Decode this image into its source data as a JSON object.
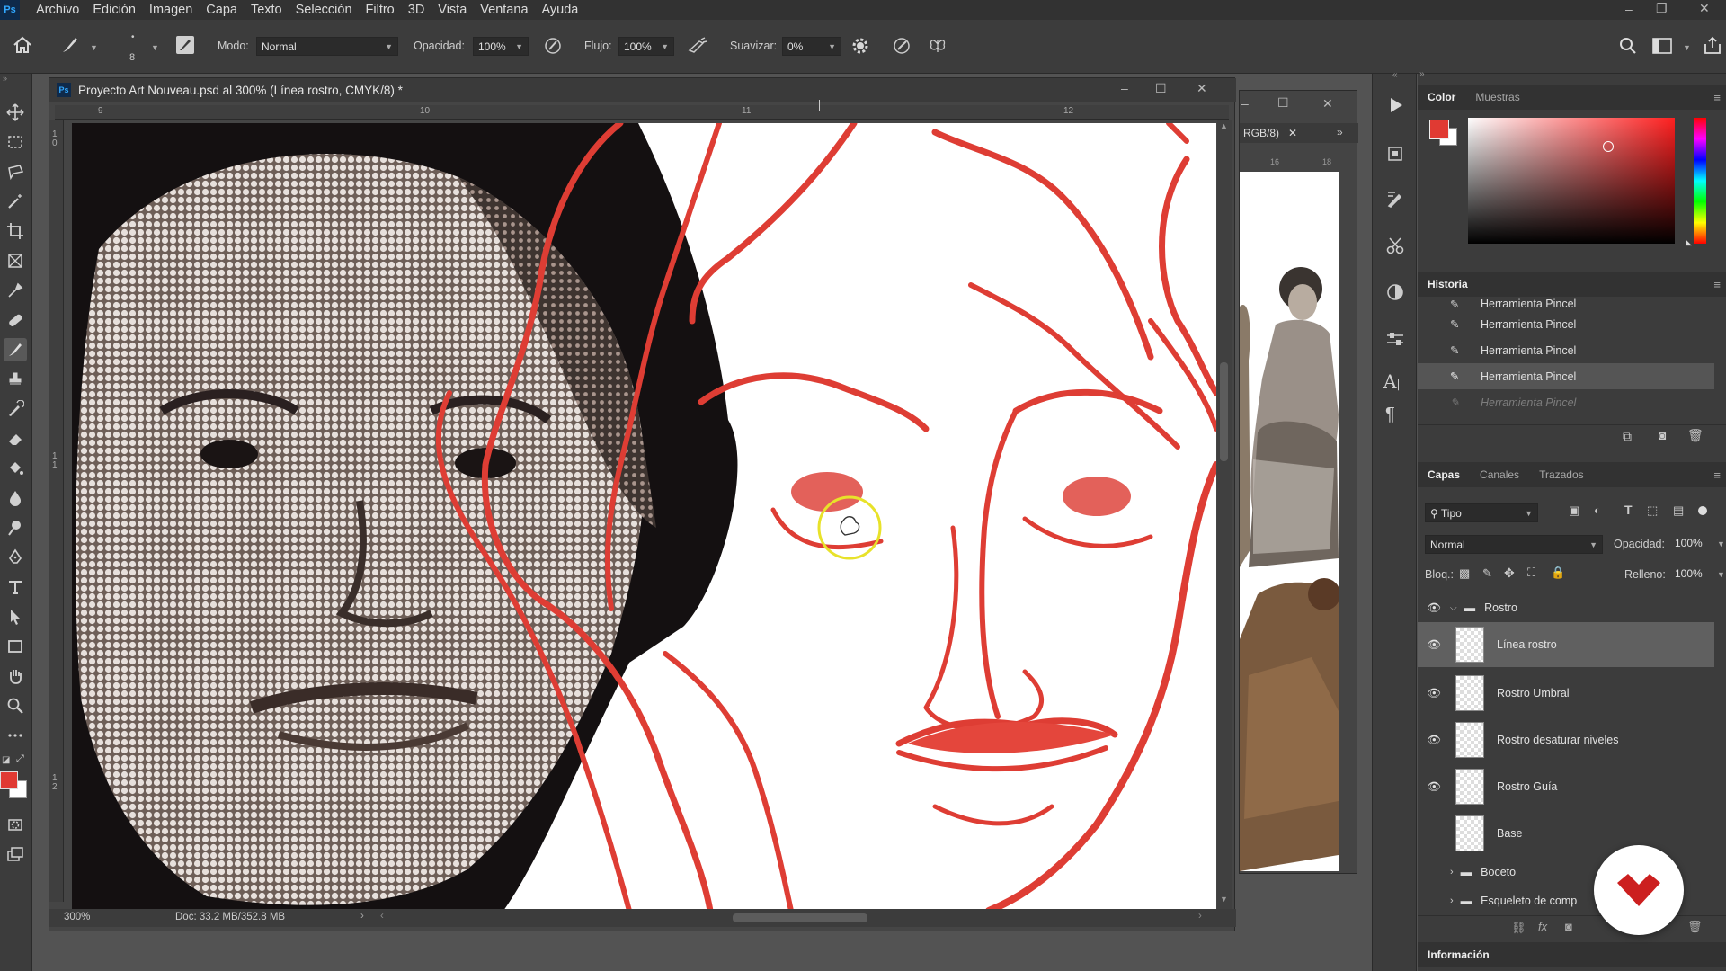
{
  "menu": {
    "logo": "Ps",
    "items": [
      "Archivo",
      "Edición",
      "Imagen",
      "Capa",
      "Texto",
      "Selección",
      "Filtro",
      "3D",
      "Vista",
      "Ventana",
      "Ayuda"
    ]
  },
  "options": {
    "brush_size": "8",
    "mode_label": "Modo:",
    "mode_value": "Normal",
    "opacity_label": "Opacidad:",
    "opacity_value": "100%",
    "flow_label": "Flujo:",
    "flow_value": "100%",
    "smooth_label": "Suavizar:",
    "smooth_value": "0%"
  },
  "document": {
    "title": "Proyecto Art Nouveau.psd al 300% (Línea rostro, CMYK/8) *",
    "zoom": "300%",
    "doc_info": "Doc: 33.2 MB/352.8 MB",
    "ruler_top": [
      "9",
      "10",
      "11",
      "12"
    ],
    "ruler_left": [
      "1\n0",
      "1\n1",
      "1\n2"
    ],
    "bg_tab": "RGB/8)",
    "bg_ruler": [
      "16",
      "18"
    ]
  },
  "color_panel": {
    "tabs": [
      "Color",
      "Muestras"
    ],
    "foreground": "#e03a33",
    "background": "#ffffff"
  },
  "history_panel": {
    "title": "Historia",
    "items": [
      "Herramienta Pincel",
      "Herramienta Pincel",
      "Herramienta Pincel",
      "Herramienta Pincel",
      "Herramienta Pincel"
    ],
    "active_index": 3
  },
  "layers_panel": {
    "tabs": [
      "Capas",
      "Canales",
      "Trazados"
    ],
    "filter": "Tipo",
    "blend_mode": "Normal",
    "opacity_label": "Opacidad:",
    "opacity_value": "100%",
    "lock_label": "Bloq.:",
    "fill_label": "Relleno:",
    "fill_value": "100%",
    "group_rostro": "Rostro",
    "layers": [
      "Línea rostro",
      "Rostro Umbral",
      "Rostro desaturar niveles",
      "Rostro Guía",
      "Base"
    ],
    "groups_below": [
      "Boceto",
      "Esqueleto de comp"
    ]
  },
  "info_panel": {
    "title": "Información"
  },
  "brand_color": "#cc1f1f"
}
